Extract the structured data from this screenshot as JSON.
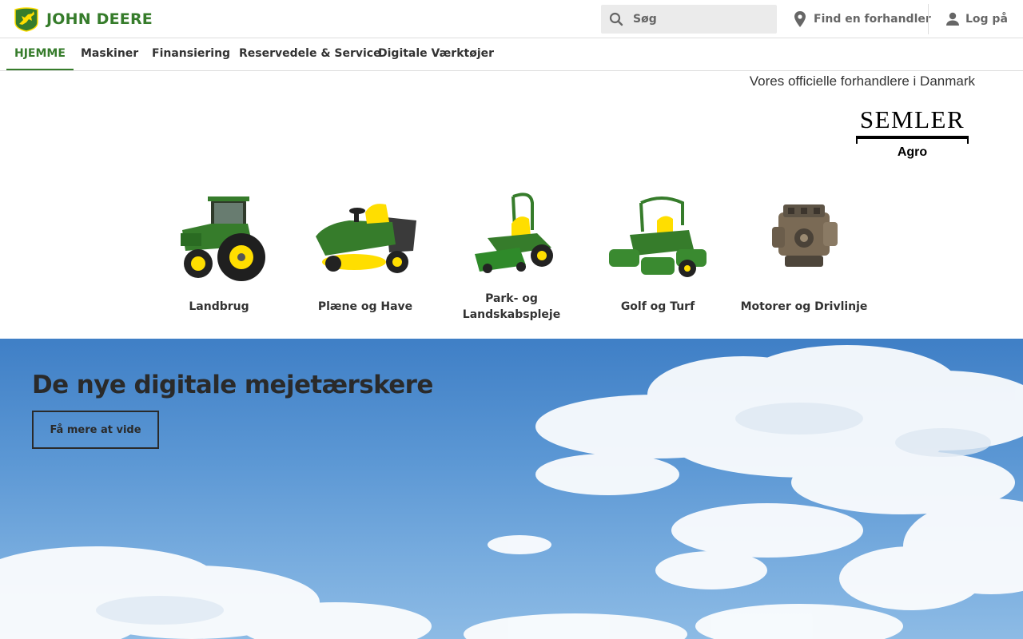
{
  "header": {
    "brand": "JOHN DEERE",
    "search_placeholder": "Søg",
    "find_dealer": "Find en forhandler",
    "login": "Log på"
  },
  "nav": {
    "items": [
      {
        "label": "HJEMME",
        "active": true
      },
      {
        "label": "Maskiner",
        "active": false
      },
      {
        "label": "Finansiering",
        "active": false
      },
      {
        "label": "Reservedele & Service",
        "active": false
      },
      {
        "label": "Digitale Værktøjer",
        "active": false
      }
    ]
  },
  "dealers": {
    "title": "Vores officielle forhandlere i Danmark",
    "logo_name": "SEMLER",
    "logo_sub": "Agro"
  },
  "categories": [
    {
      "label": "Landbrug",
      "icon": "tractor-icon"
    },
    {
      "label": "Plæne og Have",
      "icon": "lawn-tractor-icon"
    },
    {
      "label": "Park- og Landskabspleje",
      "icon": "zero-turn-mower-icon"
    },
    {
      "label": "Golf og Turf",
      "icon": "reel-mower-icon"
    },
    {
      "label": "Motorer og Drivlinje",
      "icon": "engine-icon"
    }
  ],
  "hero": {
    "title": "De nye digitale mejetærskere",
    "button": "Få mere at vide"
  },
  "colors": {
    "brand_green": "#367c2b",
    "brand_yellow": "#ffde00",
    "sky": "#5b97d4"
  }
}
